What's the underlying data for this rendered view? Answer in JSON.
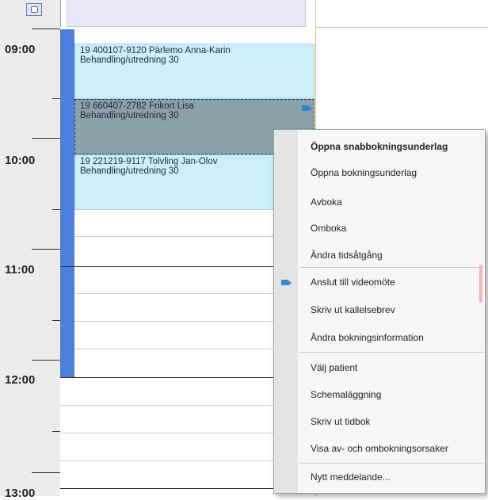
{
  "times": [
    "09:00",
    "10:00",
    "11:00",
    "12:00",
    "13:00"
  ],
  "appointments": [
    {
      "line1": "19 400107-9120  Pärlemo Anna-Karin",
      "line2": "Behandling/utredning 30",
      "bg": "#cdeefa"
    },
    {
      "line1": "19 660407-2782  Frikort Lisa",
      "line2": "Behandling/utredning 30",
      "bg": "#8aa0aa"
    },
    {
      "line1": "19 221219-9117  Tolvling Jan-Olov",
      "line2": "Behandling/utredning 30",
      "bg": "#cdeefa"
    }
  ],
  "context_menu": {
    "items": [
      {
        "label": "Öppna snabbokningsunderlag",
        "bold": true
      },
      {
        "label": "Öppna bokningsunderlag"
      },
      {
        "label": "Avboka"
      },
      {
        "label": "Omboka"
      },
      {
        "label": "Ändra tidsåtgång"
      },
      {
        "label": "Anslut till videomöte",
        "icon": "video-camera-icon"
      },
      {
        "label": "Skriv ut kallelsebrev"
      },
      {
        "label": "Ändra bokningsinformation"
      },
      {
        "label": "Välj patient"
      },
      {
        "label": "Schemaläggning"
      },
      {
        "label": "Skriv ut tidbok"
      },
      {
        "label": "Visa av- och ombokningsorsaker"
      },
      {
        "label": "Nytt meddelande..."
      }
    ]
  },
  "colors": {
    "strip": "#4d7fe0",
    "appointment_light": "#cdeefa",
    "appointment_selected": "#8aa0aa",
    "header_purple": "#e8e6f7",
    "video_icon": "#2f86d6"
  },
  "icons": [
    "calendar-icon",
    "video-camera-icon"
  ]
}
